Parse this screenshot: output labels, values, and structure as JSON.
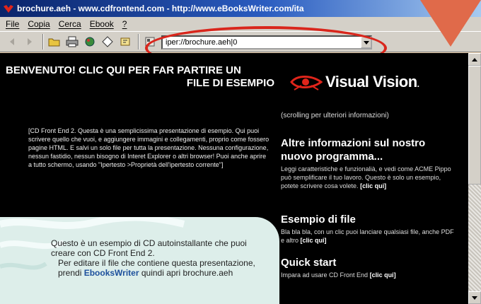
{
  "window": {
    "title": "brochure.aeh - www.cdfrontend.com - http://www.eBooksWriter.com/ita"
  },
  "menu": [
    "File",
    "Copia",
    "Cerca",
    "Ebook",
    "?"
  ],
  "address": {
    "value": "iper://brochure.aeh|0"
  },
  "toolbar_icons": [
    "back-icon",
    "forward-icon",
    "open-folder-icon",
    "print-icon",
    "paint-icon",
    "diamond-icon",
    "bookmark-icon",
    "properties-icon"
  ],
  "content": {
    "welcome_line1": "BENVENUTO! CLIC QUI PER FAR PARTIRE UN",
    "welcome_line2": "FILE DI ESEMPIO",
    "description": "[CD Front End 2. Questa è una semplicissima presentazione di esempio. Qui puoi scrivere quello che vuoi, e aggiungere immagini e collegamenti, proprio come fossero pagine HTML. E salvi un solo file per tutta la presentazione. Nessuna configurazione, nessun fastidio, nessun bisogno di Interet Explorer o altri browser! Puoi anche aprire a tutto schermo, usando \"Ipertesto >Proprietà dell'ipertesto corrente\"]",
    "cd_text_1": "Questo è un esempio di CD autoinstallante che puoi creare con CD Front End 2.",
    "cd_text_2": "Per editare il file che contiene questa presentazione, prendi",
    "cd_link": "EbooksWriter",
    "cd_text_3": "quindi apri brochure.aeh",
    "logo_text": "Visual Vision",
    "logo_dot": ".",
    "scroll_note": "(scrolling per ulteriori informazioni)",
    "sec1_title": "Altre informazioni sul nostro nuovo programma...",
    "sec1_body": "Leggi caratteristiche e funzionalià, e vedi come ACME Pippo può semplificare il tuo lavoro. Questo è solo un esempio, potete scrivere cosa volete.",
    "sec2_title": "Esempio di file",
    "sec2_body": "Bla bla bla, con un clic puoi lanciare qualsiasi file, anche PDF e altro",
    "sec3_title": "Quick start",
    "sec3_body": "Impara ad usare CD Front End",
    "clic_label": "[clic qui]"
  },
  "colors": {
    "highlight": "#d9261c",
    "triangle": "#e06a4a",
    "logo_red": "#e0251b",
    "link": "#1c4f9c"
  }
}
